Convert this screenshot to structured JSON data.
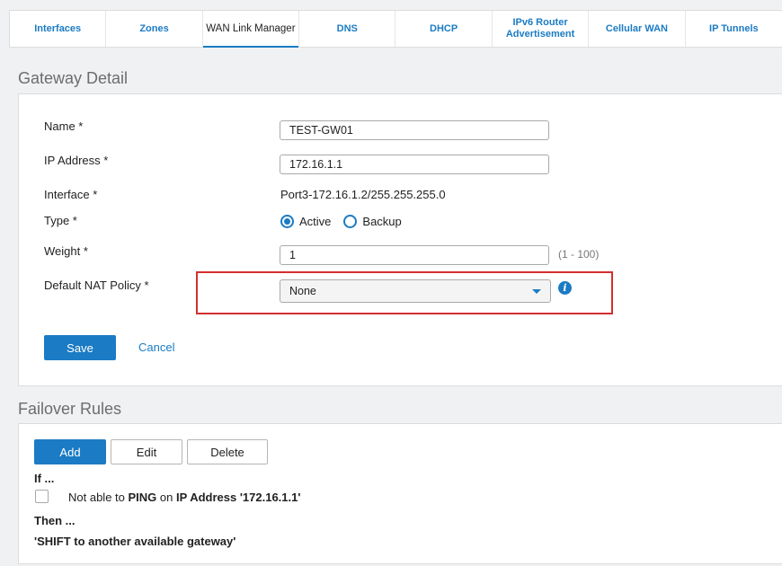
{
  "tabs": [
    {
      "label": "Interfaces",
      "active": false
    },
    {
      "label": "Zones",
      "active": false
    },
    {
      "label": "WAN Link Manager",
      "active": true
    },
    {
      "label": "DNS",
      "active": false
    },
    {
      "label": "DHCP",
      "active": false
    },
    {
      "label": "IPv6 Router Advertisement",
      "active": false
    },
    {
      "label": "Cellular WAN",
      "active": false
    },
    {
      "label": "IP Tunnels",
      "active": false
    }
  ],
  "gateway_detail": {
    "title": "Gateway Detail",
    "name_label": "Name *",
    "name_value": "TEST-GW01",
    "ip_label": "IP Address *",
    "ip_value": "172.16.1.1",
    "interface_label": "Interface *",
    "interface_value": "Port3-172.16.1.2/255.255.255.0",
    "type_label": "Type *",
    "type_options": [
      "Active",
      "Backup"
    ],
    "type_selected": "Active",
    "weight_label": "Weight *",
    "weight_value": "1",
    "weight_hint": "(1 - 100)",
    "nat_label": "Default NAT Policy *",
    "nat_value": "None",
    "save_label": "Save",
    "cancel_label": "Cancel"
  },
  "failover_rules": {
    "title": "Failover Rules",
    "add_label": "Add",
    "edit_label": "Edit",
    "delete_label": "Delete",
    "if_label": "If ...",
    "rule_prefix": "Not able to",
    "rule_method": "PING",
    "rule_on": "on",
    "rule_target": "IP Address '172.16.1.1'",
    "then_label": "Then ...",
    "then_action": "'SHIFT to another available gateway'"
  },
  "colors": {
    "accent": "#1b7bc4",
    "highlight": "#d32f2f"
  },
  "icons": {
    "nat_info": "info-icon",
    "nat_dropdown": "chevron-down-icon"
  }
}
